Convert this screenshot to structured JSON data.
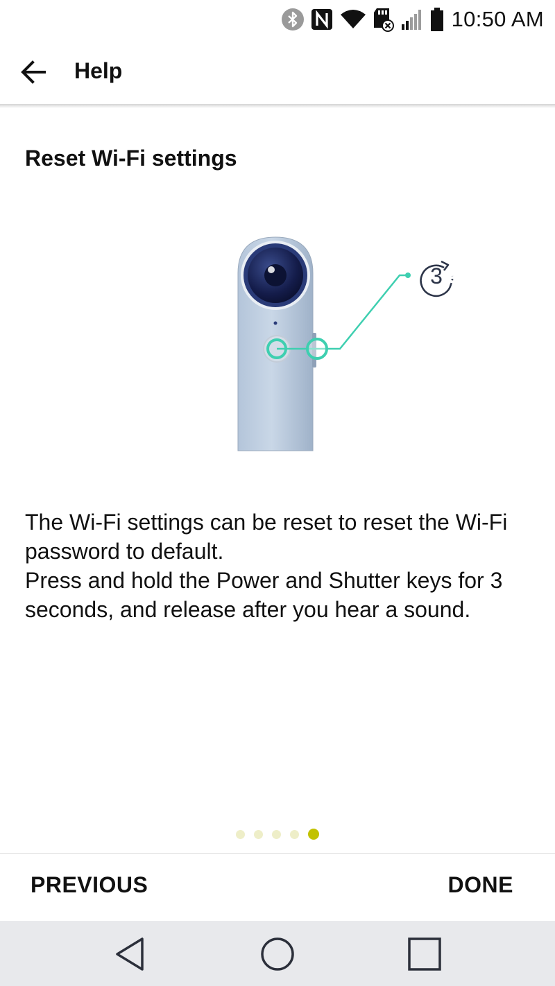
{
  "status_bar": {
    "time": "10:50 AM",
    "icons": [
      "bluetooth-icon",
      "nfc-icon",
      "wifi-icon",
      "sd-card-icon",
      "signal-icon",
      "battery-icon"
    ]
  },
  "app_bar": {
    "back_icon": "arrow-left-icon",
    "title": "Help"
  },
  "content": {
    "section_title": "Reset Wi-Fi settings",
    "illustration_badge": "3",
    "description_lines": [
      "The Wi-Fi settings can be reset to reset the Wi-Fi password to default.",
      "Press and hold the Power and Shutter keys for 3 seconds, and release after you hear a sound."
    ]
  },
  "pager": {
    "total_pages": 5,
    "current_page": 5
  },
  "actions": {
    "previous_label": "PREVIOUS",
    "done_label": "DONE"
  },
  "nav_bar": {
    "icons": [
      "back-triangle-icon",
      "home-circle-icon",
      "recents-square-icon"
    ]
  },
  "colors": {
    "accent_dot": "#c2c200",
    "inactive_dot": "#eeeec8",
    "teal_line": "#3ecfb0",
    "nav_bar_bg": "#e8e9ec"
  }
}
